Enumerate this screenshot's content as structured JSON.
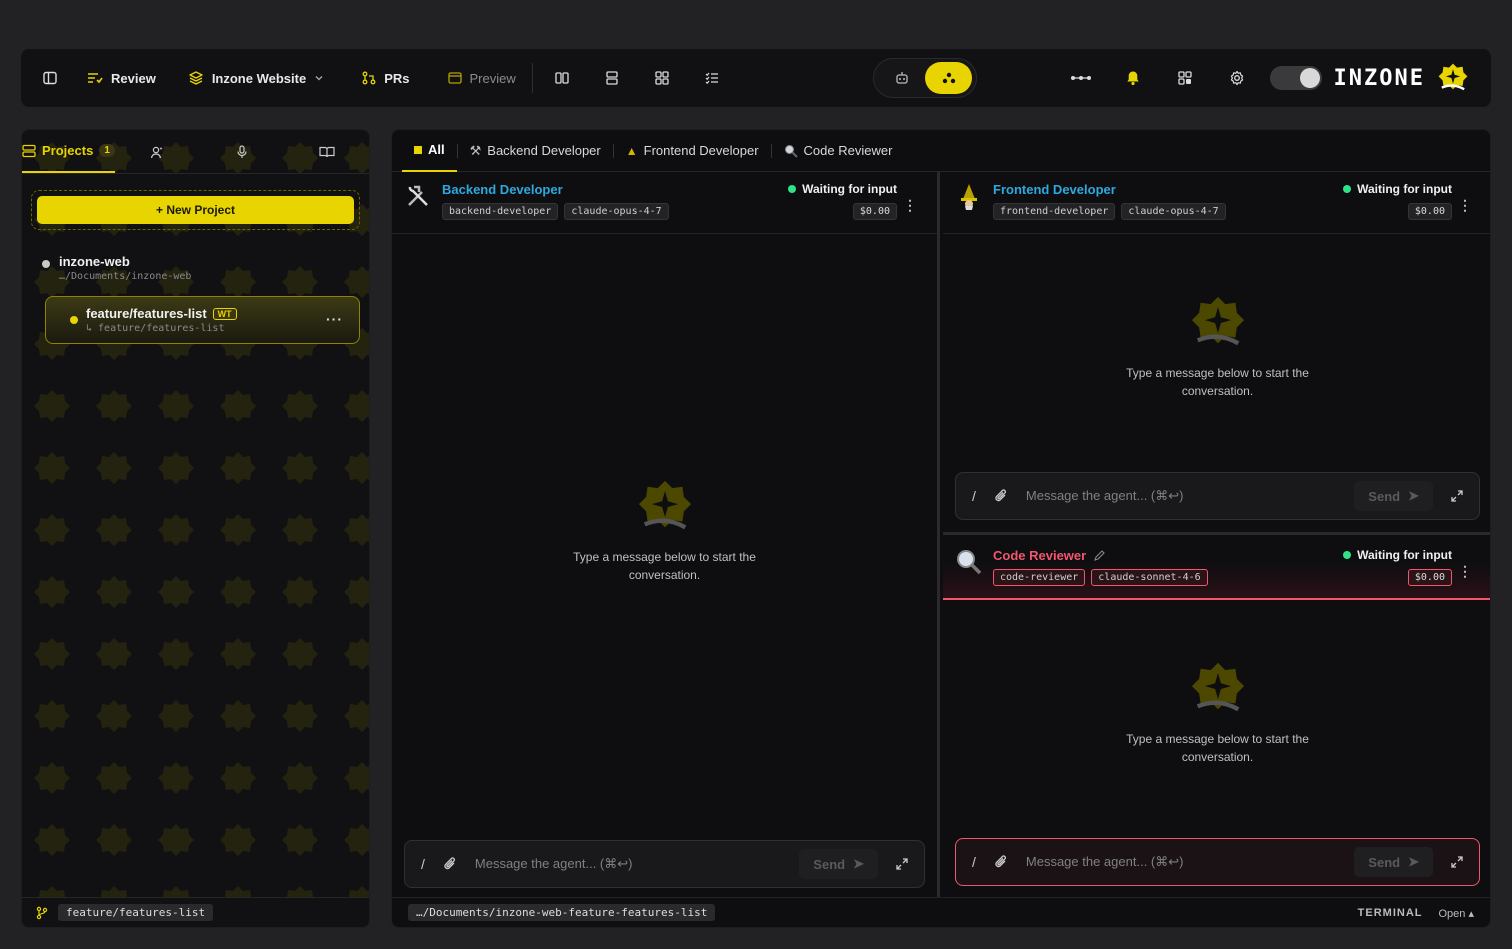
{
  "topbar": {
    "review_label": "Review",
    "project_label": "Inzone Website",
    "prs_label": "PRs",
    "preview_label": "Preview",
    "brand": "INZONE"
  },
  "sidebar": {
    "tabs": [
      {
        "label": "Projects",
        "count": "1"
      }
    ],
    "new_project_label": "+ New Project",
    "project": {
      "name": "inzone-web",
      "path": "…/Documents/inzone-web"
    },
    "worktree": {
      "name": "feature/features-list",
      "badge": "WT",
      "branch": "↳ feature/features-list"
    },
    "footer_branch": "feature/features-list"
  },
  "main": {
    "tabs": [
      "All",
      "Backend Developer",
      "Frontend Developer",
      "Code Reviewer"
    ],
    "empty_message": "Type a message below to start the conversation.",
    "composer": {
      "placeholder": "Message the agent... (⌘↩)",
      "send_label": "Send"
    },
    "footer_path": "…/Documents/inzone-web-feature-features-list",
    "terminal_label": "TERMINAL",
    "open_label": "Open ▴"
  },
  "agents": [
    {
      "name": "Backend Developer",
      "color": "#2ea9e0",
      "tags": [
        "backend-developer",
        "claude-opus-4-7"
      ],
      "status": "Waiting for input",
      "cost": "$0.00"
    },
    {
      "name": "Frontend Developer",
      "color": "#2ea9e0",
      "tags": [
        "frontend-developer",
        "claude-opus-4-7"
      ],
      "status": "Waiting for input",
      "cost": "$0.00"
    },
    {
      "name": "Code Reviewer",
      "color": "#f0566e",
      "tags": [
        "code-reviewer",
        "claude-sonnet-4-6"
      ],
      "status": "Waiting for input",
      "cost": "$0.00"
    }
  ],
  "colors": {
    "accent": "#e7d400",
    "status_green": "#2ee389",
    "reviewer_red": "#f0566e"
  }
}
